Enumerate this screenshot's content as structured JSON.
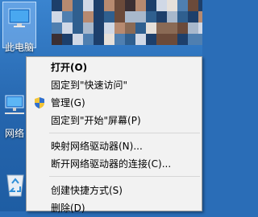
{
  "desktop": {
    "icons": [
      {
        "label": "此电脑",
        "icon": "this-pc-icon",
        "selected": true
      },
      {
        "label": "网络",
        "icon": "network-icon"
      },
      {
        "label": "",
        "icon": "recycle-bin-icon"
      }
    ]
  },
  "context_menu": {
    "items": [
      {
        "label": "打开(O)",
        "bold": true
      },
      {
        "label": "固定到\"快速访问\""
      },
      {
        "label": "管理(G)",
        "icon": "shield-icon"
      },
      {
        "label": "固定到\"开始\"屏幕(P)"
      },
      {
        "label": "映射网络驱动器(N)..."
      },
      {
        "label": "断开网络驱动器的连接(C)..."
      },
      {
        "label": "创建快捷方式(S)"
      },
      {
        "label": "删除(D)"
      }
    ]
  },
  "colors": {
    "menu_bg": "#f2f2f2",
    "selection": "#99c9ff",
    "wallpaper": "#2565ad"
  }
}
